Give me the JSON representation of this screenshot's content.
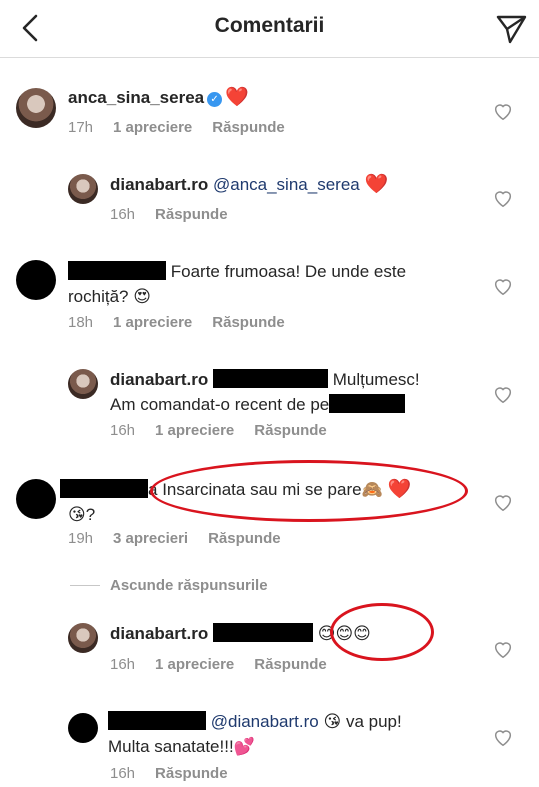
{
  "header": {
    "title": "Comentarii",
    "back_icon": "chevron-left-icon",
    "send_icon": "paper-plane-icon"
  },
  "toggle_replies_label": "Ascunde răspunsurile",
  "comments": [
    {
      "username": "anca_sina_serea",
      "verified": true,
      "text": "❤️",
      "time": "17h",
      "likes": "1 apreciere",
      "reply": "Răspunde"
    },
    {
      "username": "dianabart.ro",
      "mention": "@anca_sina_serea",
      "text": "❤️",
      "time": "16h",
      "reply": "Răspunde"
    },
    {
      "text_line1": "Foarte frumoasa! De unde este",
      "text_line2": "rochiță?",
      "emoji": "😍",
      "time": "18h",
      "likes": "1 apreciere",
      "reply": "Răspunde"
    },
    {
      "username": "dianabart.ro",
      "text_line1": "Mulțumesc!",
      "text_line2": "Am comandat-o recent de pe",
      "time": "16h",
      "likes": "1 apreciere",
      "reply": "Răspunde"
    },
    {
      "prefix": "a",
      "text_line1": "Insarcinata sau mi se pare",
      "emoji1": "🙈",
      "emoji2": "❤️",
      "emoji3": "😘",
      "text_end": "?",
      "time": "19h",
      "likes": "3 aprecieri",
      "reply": "Răspunde"
    },
    {
      "username": "dianabart.ro",
      "emojis": "😊😊😊",
      "time": "16h",
      "likes": "1 apreciere",
      "reply": "Răspunde"
    },
    {
      "mention": "@dianabart.ro",
      "emoji": "😘",
      "text_line1": "va pup!",
      "text_line2": "Multa sanatate!!!",
      "emoji2": "💕",
      "time": "16h",
      "reply": "Răspunde"
    }
  ],
  "colors": {
    "text": "#262626",
    "meta": "#8e8e8e",
    "annotation_red": "#d9141e",
    "verified_blue": "#3897f0"
  }
}
